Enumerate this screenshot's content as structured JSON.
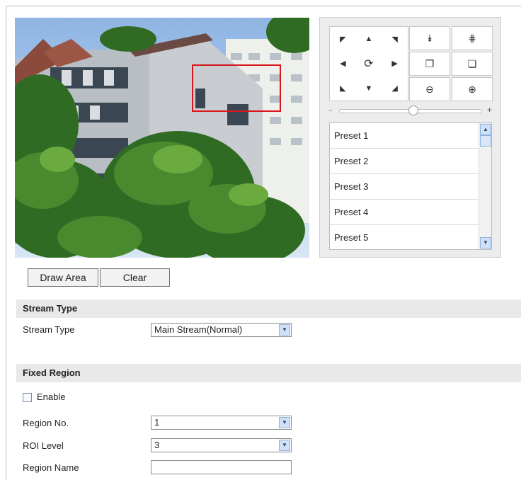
{
  "video": {
    "roi_label": "ROI area"
  },
  "ptz": {
    "directions": [
      "◤",
      "▲",
      "◥",
      "◀",
      "⟳",
      "▶",
      "◣",
      "▼",
      "◢"
    ],
    "direction_icons": [
      "up-left-arrow-icon",
      "up-arrow-icon",
      "up-right-arrow-icon",
      "left-arrow-icon",
      "auto-pan-icon",
      "right-arrow-icon",
      "down-left-arrow-icon",
      "down-arrow-icon",
      "down-right-arrow-icon"
    ],
    "ops": [
      "⯯",
      "⋕",
      "❐",
      "❏",
      "⊖",
      "⊕"
    ],
    "op_icons": [
      "focus-near-icon",
      "focus-far-icon",
      "zoom-out-icon",
      "zoom-in-icon",
      "iris-close-icon",
      "iris-open-icon"
    ],
    "slider_minus": "-",
    "slider_plus": "+",
    "presets": [
      "Preset 1",
      "Preset 2",
      "Preset 3",
      "Preset 4",
      "Preset 5"
    ]
  },
  "buttons": {
    "draw_area": "Draw Area",
    "clear": "Clear"
  },
  "stream": {
    "section_title": "Stream Type",
    "label": "Stream Type",
    "value": "Main Stream(Normal)"
  },
  "fixed_region": {
    "section_title": "Fixed Region",
    "enable_label": "Enable",
    "region_no_label": "Region No.",
    "region_no_value": "1",
    "roi_level_label": "ROI Level",
    "roi_level_value": "3",
    "region_name_label": "Region Name",
    "region_name_value": ""
  }
}
